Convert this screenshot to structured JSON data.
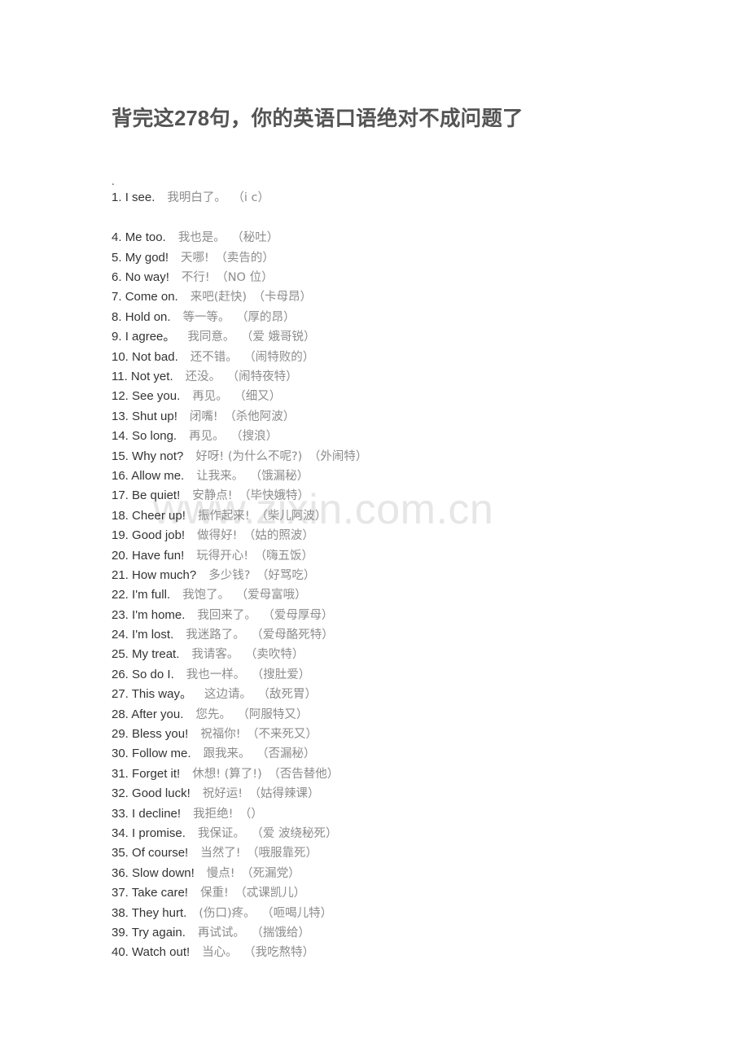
{
  "document": {
    "title": "背完这278句，你的英语口语绝对不成问题了",
    "lead_marker": ".",
    "watermark": "www.zixin.com.cn"
  },
  "phrases": [
    {
      "num": "1.",
      "en": "I see.",
      "zh": "我明白了。",
      "phonetic": "（i c）"
    },
    {
      "num": "4.",
      "en": "Me too.",
      "zh": "我也是。",
      "phonetic": "（秘吐）"
    },
    {
      "num": "5.",
      "en": "My god!",
      "zh": "天哪!",
      "phonetic": "（卖告的）"
    },
    {
      "num": "6.",
      "en": "No way!",
      "zh": "不行!",
      "phonetic": "（NO 位）"
    },
    {
      "num": "7.",
      "en": "Come on.",
      "zh": "来吧(赶快)",
      "phonetic": "（卡母昂）"
    },
    {
      "num": "8.",
      "en": "Hold on.",
      "zh": "等一等。",
      "phonetic": "（厚的昂）"
    },
    {
      "num": "9.",
      "en": "I agree。",
      "zh": "我同意。",
      "phonetic": "（爱 娥哥锐）"
    },
    {
      "num": "10.",
      "en": "Not bad.",
      "zh": "还不错。",
      "phonetic": "（闹特败的）"
    },
    {
      "num": "11.",
      "en": "Not yet.",
      "zh": "还没。",
      "phonetic": "（闹特夜特）"
    },
    {
      "num": "12.",
      "en": "See you.",
      "zh": "再见。",
      "phonetic": "（细又）"
    },
    {
      "num": "13.",
      "en": "Shut up!",
      "zh": "闭嘴!",
      "phonetic": "（杀他阿波）"
    },
    {
      "num": "14.",
      "en": "So long.",
      "zh": "再见。",
      "phonetic": "（搜浪）"
    },
    {
      "num": "15.",
      "en": "Why not?",
      "zh": "好呀! (为什么不呢?)",
      "phonetic": "（外闹特）"
    },
    {
      "num": "16.",
      "en": "Allow me.",
      "zh": "让我来。",
      "phonetic": "（饿漏秘）"
    },
    {
      "num": "17.",
      "en": "Be quiet!",
      "zh": "安静点!",
      "phonetic": "（毕快娥特）"
    },
    {
      "num": "18.",
      "en": "Cheer up!",
      "zh": "振作起来!",
      "phonetic": "（柴儿阿波）"
    },
    {
      "num": "19.",
      "en": "Good job!",
      "zh": "做得好!",
      "phonetic": "（姑的照波）"
    },
    {
      "num": "20.",
      "en": "Have fun!",
      "zh": "玩得开心!",
      "phonetic": "（嗨五饭）"
    },
    {
      "num": "21.",
      "en": "How much?",
      "zh": "多少钱?",
      "phonetic": "（好骂吃）"
    },
    {
      "num": "22.",
      "en": "I'm full.",
      "zh": "我饱了。",
      "phonetic": "（爱母富哦）"
    },
    {
      "num": "23.",
      "en": "I'm home.",
      "zh": "我回来了。",
      "phonetic": "（爱母厚母）"
    },
    {
      "num": "24.",
      "en": "I'm lost.",
      "zh": "我迷路了。",
      "phonetic": "（爱母酪死特）"
    },
    {
      "num": "25.",
      "en": "My treat.",
      "zh": "我请客。",
      "phonetic": "（卖吹特）"
    },
    {
      "num": "26.",
      "en": "So do I.",
      "zh": "我也一样。",
      "phonetic": "（搜肚爱）"
    },
    {
      "num": "27.",
      "en": "This way。",
      "zh": "这边请。",
      "phonetic": "（敌死胃）"
    },
    {
      "num": "28.",
      "en": "After you.",
      "zh": "您先。",
      "phonetic": "（阿服特又）"
    },
    {
      "num": "29.",
      "en": "Bless you!",
      "zh": "祝福你!",
      "phonetic": "（不来死又）"
    },
    {
      "num": "30.",
      "en": "Follow me.",
      "zh": "跟我来。",
      "phonetic": "（否漏秘）"
    },
    {
      "num": "31.",
      "en": "Forget it!",
      "zh": "休想! (算了!)",
      "phonetic": "（否告替他）"
    },
    {
      "num": "32.",
      "en": "Good luck!",
      "zh": "祝好运!",
      "phonetic": "（姑得辣课）"
    },
    {
      "num": "33.",
      "en": "I decline!",
      "zh": "我拒绝!",
      "phonetic": "（）"
    },
    {
      "num": "34.",
      "en": "I promise.",
      "zh": "我保证。",
      "phonetic": "（爱 波绕秘死）"
    },
    {
      "num": "35.",
      "en": "Of course!",
      "zh": "当然了!",
      "phonetic": "（哦服靠死）"
    },
    {
      "num": "36.",
      "en": "Slow down!",
      "zh": "慢点!",
      "phonetic": "（死漏党）"
    },
    {
      "num": "37.",
      "en": "Take care!",
      "zh": "保重!",
      "phonetic": "（忒课凯儿）"
    },
    {
      "num": "38.",
      "en": "They hurt.",
      "zh": "(伤口)疼。",
      "phonetic": "（咂喝儿特）"
    },
    {
      "num": "39.",
      "en": "Try again.",
      "zh": "再试试。",
      "phonetic": "（揣饿给）"
    },
    {
      "num": "40.",
      "en": "Watch out!",
      "zh": "当心。",
      "phonetic": "（我吃熬特）"
    }
  ],
  "colors": {
    "page_background": "#ffffff",
    "title": "#545454",
    "english_text": "#333333",
    "chinese_text": "#8c8c8c",
    "watermark": "#e6e6e6"
  }
}
